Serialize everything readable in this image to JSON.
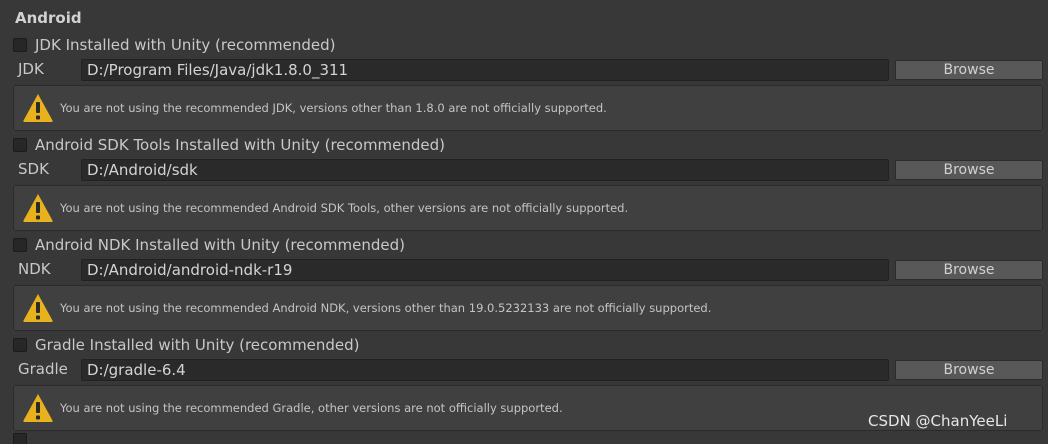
{
  "section": {
    "title": "Android"
  },
  "groups": [
    {
      "checkbox_label": "JDK Installed with Unity (recommended)",
      "path_label": "JDK",
      "path_value": "D:/Program Files/Java/jdk1.8.0_311",
      "browse_label": "Browse",
      "warning": "You are not using the recommended JDK, versions other than 1.8.0 are not officially supported."
    },
    {
      "checkbox_label": "Android SDK Tools Installed with Unity (recommended)",
      "path_label": "SDK",
      "path_value": "D:/Android/sdk",
      "browse_label": "Browse",
      "warning": "You are not using the recommended Android SDK Tools, other versions are not officially supported."
    },
    {
      "checkbox_label": "Android NDK Installed with Unity (recommended)",
      "path_label": "NDK",
      "path_value": "D:/Android/android-ndk-r19",
      "browse_label": "Browse",
      "warning": "You are not using the recommended Android NDK, versions other than 19.0.5232133 are not officially supported."
    },
    {
      "checkbox_label": "Gradle Installed with Unity (recommended)",
      "path_label": "Gradle",
      "path_value": "D:/gradle-6.4",
      "browse_label": "Browse",
      "warning": "You are not using the recommended Gradle, other versions are not officially supported."
    }
  ],
  "watermark": "CSDN @ChanYeeLi",
  "colors": {
    "background": "#383838",
    "warning_icon": "#e8b21e",
    "button": "#585858",
    "field": "#2a2a2a"
  },
  "icons": {
    "warning": "warning-triangle-icon"
  }
}
